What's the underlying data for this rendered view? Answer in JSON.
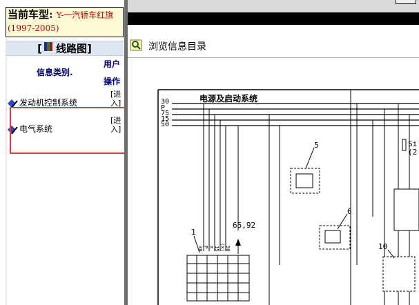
{
  "vehicle": {
    "label": "当前车型:",
    "name": "Y-一汽轿车红旗",
    "years": "(1997-2005)"
  },
  "wiring": {
    "title": "线路图"
  },
  "table": {
    "col_category": "信息类别.",
    "col_user": "用户",
    "col_action": "操作"
  },
  "systems": [
    {
      "label": "发动机控制系统",
      "action": "[进入]"
    },
    {
      "label": "电气系统",
      "action": "[进入]"
    }
  ],
  "toolbar": {
    "browse_label": "浏览信息目录"
  },
  "diagram": {
    "title": "电源及启动系统",
    "bus_labels": [
      "30",
      "P",
      "75",
      "15",
      "50"
    ],
    "components": [
      "5",
      "6",
      "1",
      "10"
    ],
    "ref_note": "65,92",
    "side_text": "Si",
    "side_text2": "(2",
    "conn_labels": [
      "30",
      "P",
      "X",
      "15",
      "(X)",
      "50"
    ]
  },
  "colors": {
    "highlight": "#e03a3a",
    "vehicle_bg": "#fffbd7",
    "vehicle_text": "#c00000",
    "header_text": "#000080"
  }
}
